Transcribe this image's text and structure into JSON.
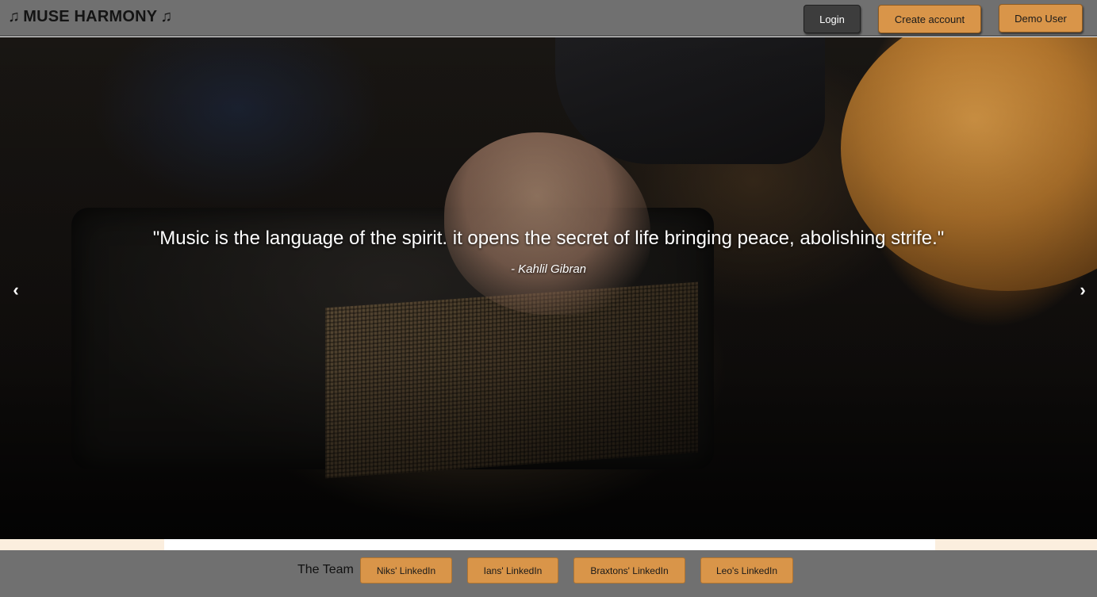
{
  "header": {
    "logo": {
      "note_icon": "music-note-icon",
      "title": "MUSE HARMONY"
    },
    "buttons": {
      "login": "Login",
      "create_account": "Create account",
      "demo_user": "Demo User"
    }
  },
  "carousel": {
    "quote": "\"Music is the language of the spirit. it opens the secret of life bringing peace, abolishing strife.\"",
    "author": "- Kahlil Gibran",
    "prev_icon": "‹",
    "next_icon": "›"
  },
  "footer": {
    "team_label": "The Team",
    "links": {
      "niks": "Niks' LinkedIn",
      "ians": "Ians' LinkedIn",
      "braxtons": "Braxtons' LinkedIn",
      "leos": "Leo's LinkedIn"
    }
  },
  "colors": {
    "header_bg": "#707070",
    "accent_orange": "#d99549",
    "login_bg": "#3d3d3d",
    "strip_cream": "#fbeede"
  }
}
